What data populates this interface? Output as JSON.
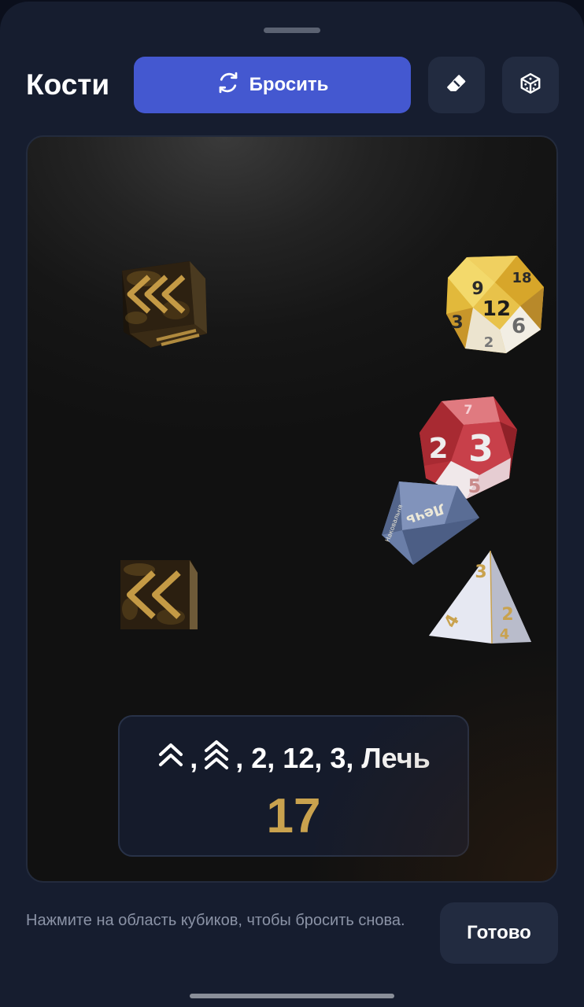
{
  "header": {
    "title": "Кости",
    "roll_button_label": "Бросить",
    "roll_icon": "refresh-icon",
    "eraser_icon": "eraser-icon",
    "dice_icon": "dice-cube-icon"
  },
  "dice": [
    {
      "type": "d6",
      "face": "double-chevron",
      "color": "#3a2a12"
    },
    {
      "type": "d20",
      "face": "12",
      "color": "#e9c24a"
    },
    {
      "type": "d12",
      "face": "3",
      "color": "#c9363e"
    },
    {
      "type": "d8",
      "face": "Лечь",
      "color": "#6b7ea8"
    },
    {
      "type": "d4",
      "face": "2",
      "color": "#d9d9e6"
    },
    {
      "type": "d6",
      "face": "double-chevron",
      "color": "#3a2a12"
    }
  ],
  "result": {
    "separator_1": ",",
    "separator_2": ",",
    "values_text": "2, 12, 3, Лечь",
    "total": "17",
    "total_color": "#c9a24e"
  },
  "footer": {
    "hint": "Нажмите на область кубиков, чтобы бросить снова.",
    "done_label": "Готово"
  }
}
